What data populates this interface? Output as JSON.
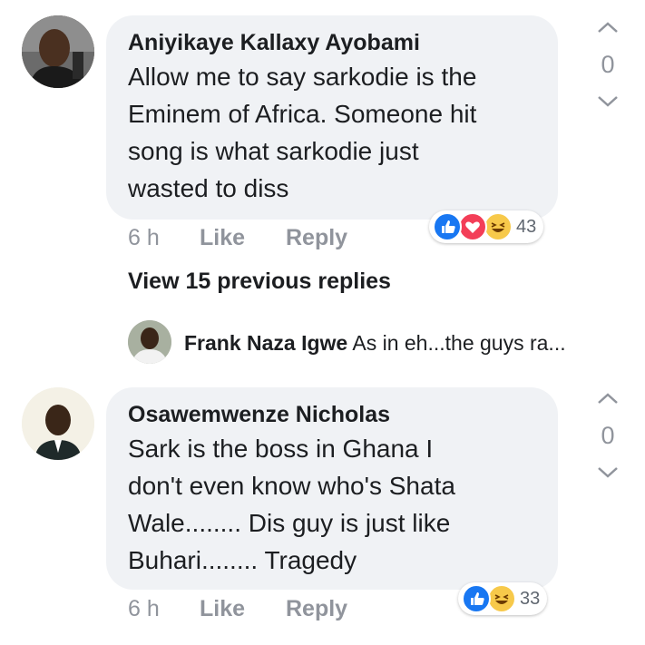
{
  "comments": [
    {
      "author": "Aniyikaye Kallaxy Ayobami",
      "lines": [
        "Allow me to say sarkodie is the",
        "Eminem of Africa. Someone hit",
        "song is what sarkodie just",
        "wasted to diss"
      ],
      "time": "6 h",
      "like_label": "Like",
      "reply_label": "Reply",
      "reaction_count": "43",
      "reactions": [
        "like-icon",
        "love-icon",
        "haha-icon"
      ],
      "vote_count": "0"
    },
    {
      "author": "Osawemwenze Nicholas",
      "lines": [
        "Sark is the boss in Ghana I",
        "don't even know who's Shata",
        "Wale........ Dis guy is just like",
        "Buhari........ Tragedy"
      ],
      "time": "6 h",
      "like_label": "Like",
      "reply_label": "Reply",
      "reaction_count": "33",
      "reactions": [
        "like-icon",
        "haha-icon"
      ],
      "vote_count": "0"
    }
  ],
  "view_previous": "View 15 previous replies",
  "reply_preview": {
    "author": "Frank Naza Igwe",
    "text": "As in eh...the guys ra..."
  },
  "colors": {
    "bubble": "#f0f2f5",
    "like_blue": "#1877f2",
    "love_red": "#f33e58",
    "haha_yellow": "#f7c94a",
    "meta_gray": "#90949c"
  }
}
